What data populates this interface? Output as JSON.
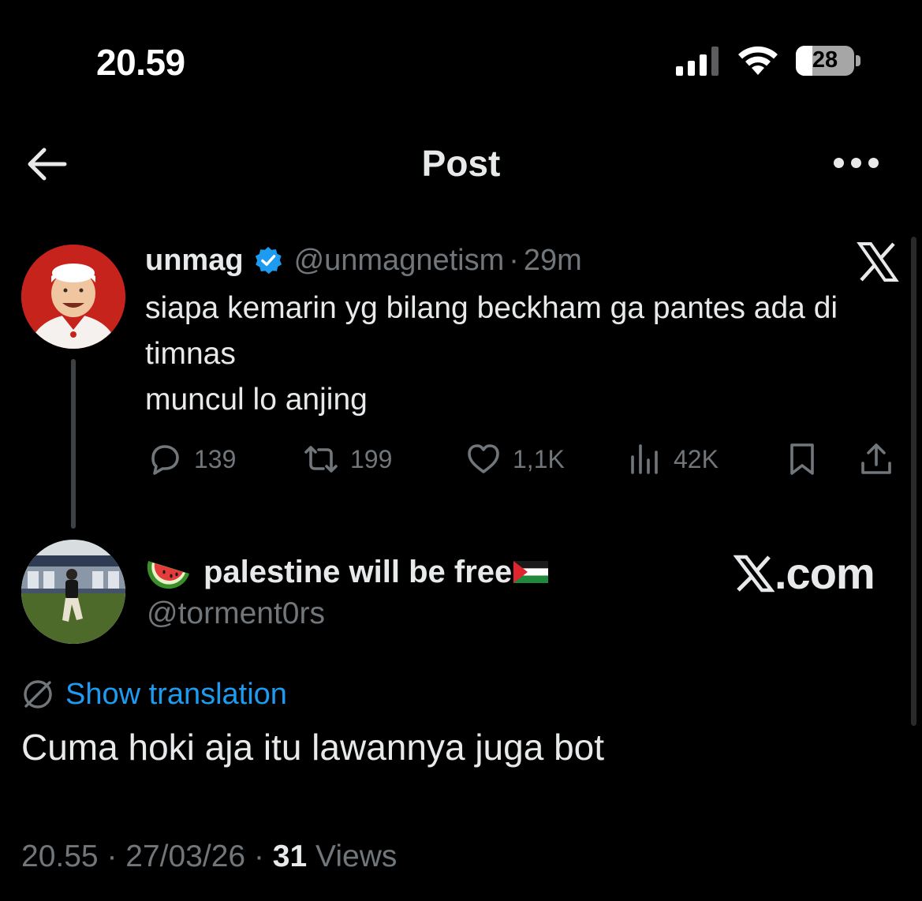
{
  "status_bar": {
    "time": "20.59",
    "battery_level": "28",
    "signal_icon": "cellular-signal-icon",
    "wifi_icon": "wifi-icon",
    "battery_icon": "battery-icon"
  },
  "header": {
    "title": "Post",
    "back_icon": "arrow-left-icon",
    "more_icon": "more-dots-icon"
  },
  "parent_tweet": {
    "display_name": "unmag",
    "verified": true,
    "handle": "@unmagnetism",
    "separator": "·",
    "time_ago": "29m",
    "text": "siapa kemarin yg bilang beckham ga pantes ada di timnas\nmuncul lo anjing",
    "stats": {
      "replies": "139",
      "reposts": "199",
      "likes": "1,1K",
      "views": "42K"
    }
  },
  "main_tweet": {
    "display_name": "palestine will be free",
    "name_emoji_prefix": "watermelon-icon",
    "name_emoji_suffix": "palestine-flag-icon",
    "handle": "@torment0rs",
    "translate_label": "Show translation",
    "text": "Cuma hoki aja itu lawannya juga bot",
    "time": "20.55",
    "date": "27/03/26",
    "separator": "·",
    "view_count": "31",
    "views_label": "Views"
  },
  "watermark": {
    "text": ".com"
  },
  "colors": {
    "background": "#000000",
    "primary_text": "#e7e9ea",
    "secondary_text": "#71767b",
    "accent": "#1d9bf0",
    "verified": "#1d9bf0"
  }
}
